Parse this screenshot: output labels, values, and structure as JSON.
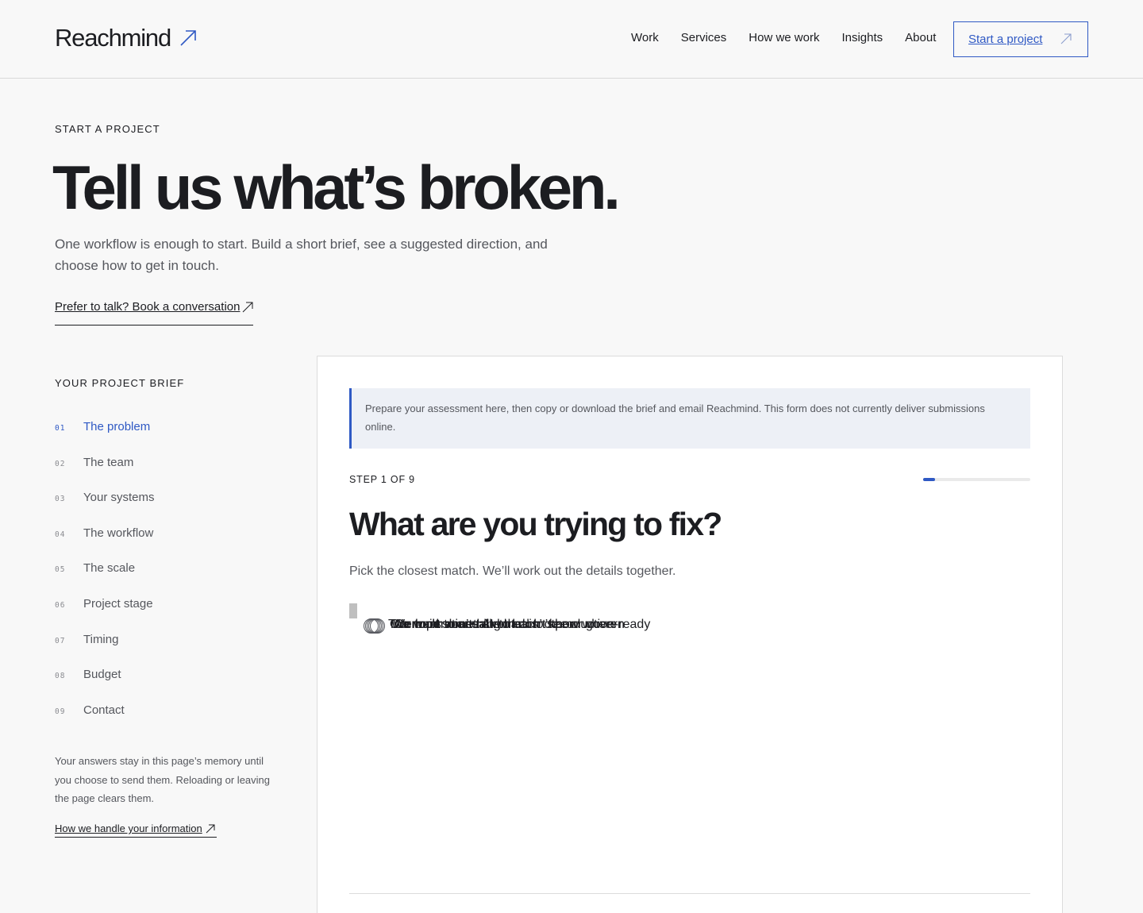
{
  "header": {
    "logo": "Reachmind",
    "nav": [
      "Work",
      "Services",
      "How we work",
      "Insights",
      "About"
    ],
    "cta_label": "Start a project"
  },
  "hero": {
    "eyebrow": "START A PROJECT",
    "title": "Tell us what’s broken.",
    "subtitle": "One workflow is enough to start. Build a short brief, see a suggested direction, and choose how to get in touch.",
    "talk_link": "Prefer to talk? Book a conversation"
  },
  "sidebar": {
    "title": "YOUR PROJECT BRIEF",
    "steps": [
      {
        "num": "01",
        "label": "The problem"
      },
      {
        "num": "02",
        "label": "The team"
      },
      {
        "num": "03",
        "label": "Your systems"
      },
      {
        "num": "04",
        "label": "The workflow"
      },
      {
        "num": "05",
        "label": "The scale"
      },
      {
        "num": "06",
        "label": "Project stage"
      },
      {
        "num": "07",
        "label": "Timing"
      },
      {
        "num": "08",
        "label": "Budget"
      },
      {
        "num": "09",
        "label": "Contact"
      }
    ],
    "active_step": 0,
    "note": "Your answers stay in this page’s memory until you choose to send them. Reloading or leaving the page clears them.",
    "privacy_link": "How we handle your information"
  },
  "form": {
    "notice": "Prepare your assessment here, then copy or download the brief and email Reachmind. This form does not currently deliver submissions online.",
    "step_label": "STEP 1 OF 9",
    "progress_fraction": 0.111,
    "question": "What are you trying to fix?",
    "hint": "Pick the closest match. We’ll work out the details together.",
    "options": [
      "Too much manual work",
      "Our tools don’t talk to each other",
      "We want to use AI but don’t know where",
      "We built something that isn’t production-ready",
      "Our operations are hard to see or govern"
    ]
  },
  "colors": {
    "accent": "#2f59c4",
    "text": "#1c1d21",
    "muted": "#55575d",
    "background": "#f8f8f8",
    "notice_bg": "#edf0f6"
  }
}
